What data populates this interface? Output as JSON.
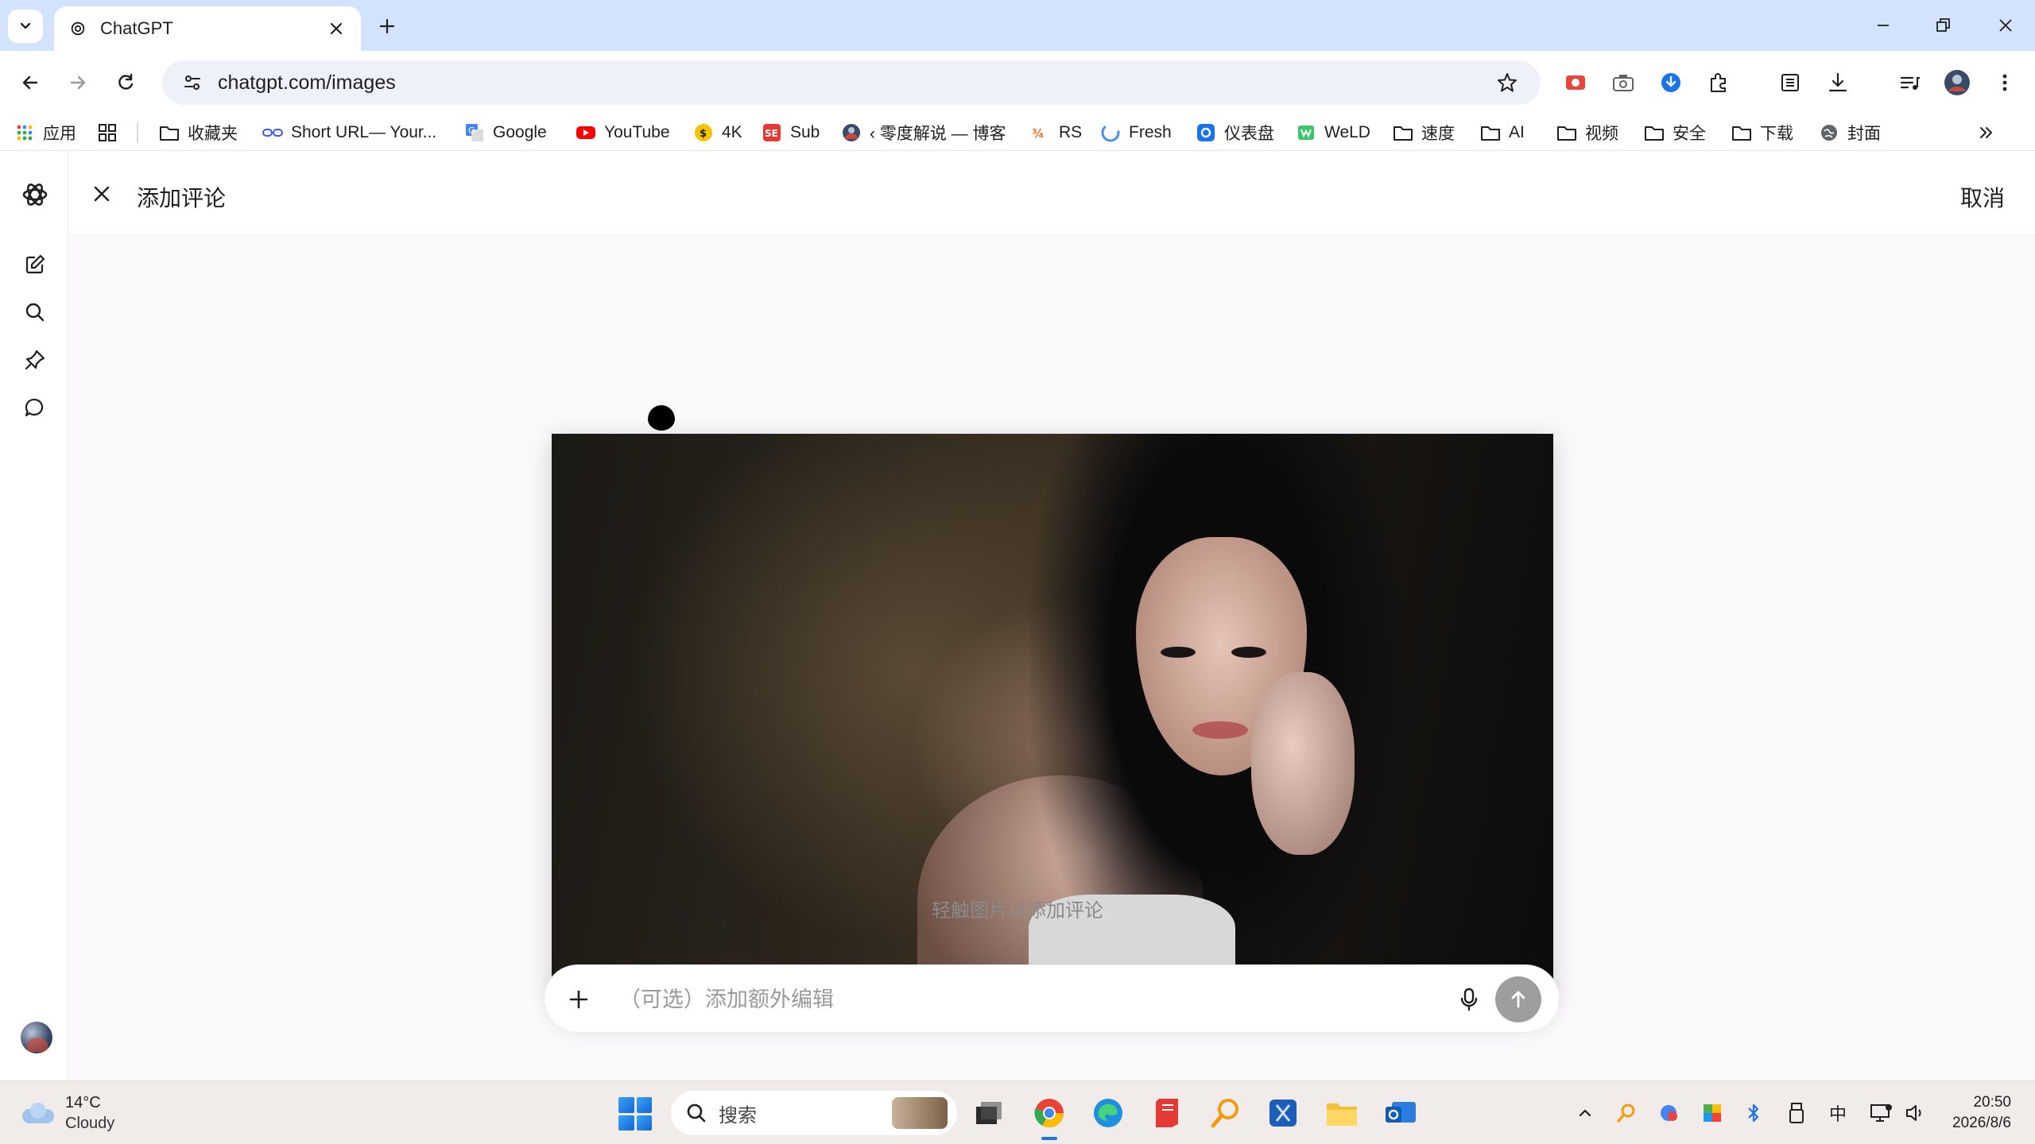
{
  "browser": {
    "tab_title": "ChatGPT",
    "url": "chatgpt.com/images"
  },
  "bookmarks": [
    {
      "label": "应用",
      "icon": "apps-grid-icon"
    },
    {
      "label": "",
      "icon": "tab-groups-icon"
    },
    {
      "label": "收藏夹",
      "icon": "folder-icon"
    },
    {
      "label": "Short URL— Your...",
      "icon": "link-icon"
    },
    {
      "label": "Google",
      "icon": "google-translate-icon"
    },
    {
      "label": "YouTube",
      "icon": "youtube-icon"
    },
    {
      "label": "4K",
      "icon": "4k-icon"
    },
    {
      "label": "Sub",
      "icon": "sub-icon"
    },
    {
      "label": "‹ 零度解说 — 博客",
      "icon": "avatar-icon"
    },
    {
      "label": "RS",
      "icon": "rs-icon"
    },
    {
      "label": "Fresh",
      "icon": "fresh-icon"
    },
    {
      "label": "仪表盘",
      "icon": "dashboard-icon"
    },
    {
      "label": "WeLD",
      "icon": "weld-icon"
    },
    {
      "label": "速度",
      "icon": "folder-icon"
    },
    {
      "label": "AI",
      "icon": "folder-icon"
    },
    {
      "label": "视频",
      "icon": "folder-icon"
    },
    {
      "label": "安全",
      "icon": "folder-icon"
    },
    {
      "label": "下载",
      "icon": "folder-icon"
    },
    {
      "label": "封面",
      "icon": "globe-icon"
    }
  ],
  "app": {
    "title": "添加评论",
    "cancel_label": "取消",
    "hint": "轻触图片以添加评论",
    "composer": {
      "placeholder": "（可选）添加额外编辑",
      "value": ""
    }
  },
  "taskbar": {
    "weather_temp": "14°C",
    "weather_cond": "Cloudy",
    "search_label": "搜索",
    "ime": "中",
    "time": "20:50",
    "date": "2026/8/6"
  },
  "colors": {
    "tabstrip": "#d3e3fd",
    "app_bg": "#fcf9fd",
    "send_button": "#9e9e9e",
    "taskbar": "#f1ebe9"
  }
}
